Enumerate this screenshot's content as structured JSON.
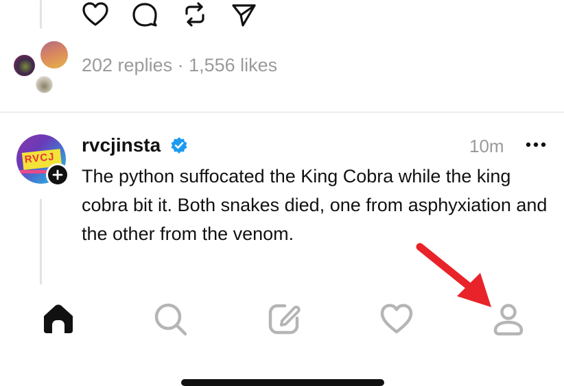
{
  "previous_post": {
    "actions": [
      {
        "name": "like-button",
        "icon": "heart-icon"
      },
      {
        "name": "comment-button",
        "icon": "comment-bubble-icon"
      },
      {
        "name": "repost-button",
        "icon": "repost-icon"
      },
      {
        "name": "share-button",
        "icon": "send-icon"
      }
    ],
    "stats": "202 replies · 1,556 likes"
  },
  "post": {
    "username": "rvcjinsta",
    "verified": true,
    "timestamp": "10m",
    "more_icon": "more-horizontal-icon",
    "avatar_logo_text": "RVCJ",
    "avatar_follow_icon": "plus-icon",
    "body": "The python suffocated the King Cobra while the king cobra bit it. Both snakes died, one from asphyxiation and the other from the venom."
  },
  "tab_bar": {
    "active": "home",
    "tabs": [
      {
        "name": "home",
        "icon": "home-icon"
      },
      {
        "name": "search",
        "icon": "search-icon"
      },
      {
        "name": "compose",
        "icon": "compose-icon"
      },
      {
        "name": "activity",
        "icon": "heart-icon"
      },
      {
        "name": "profile",
        "icon": "profile-icon"
      }
    ]
  },
  "annotation": {
    "icon": "red-arrow-icon",
    "color": "#e8232a"
  },
  "colors": {
    "verified": "#1d9bf0",
    "active_tab": "#111111",
    "inactive_tab": "#b5b5b5"
  }
}
